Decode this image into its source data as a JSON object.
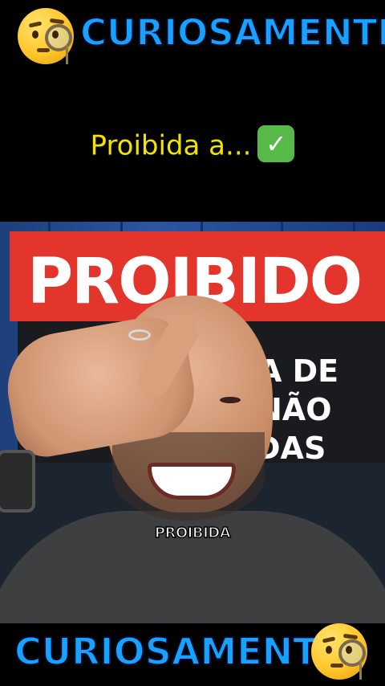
{
  "brand": {
    "top_title": "CURIOSAMENTE",
    "bottom_title": "CURIOSAMENTE",
    "emoji_icon": "face-with-monocle-icon"
  },
  "headline": {
    "text": "Proibida a...",
    "check_icon": "check-mark-button-icon"
  },
  "video": {
    "sign": {
      "main_word": "PROIBIDO",
      "line_1": "A DE",
      "line_2": "NÃO",
      "line_3": "DAS"
    },
    "caption": "PROIBIDA"
  },
  "colors": {
    "brand_blue": "#17a2ff",
    "headline_yellow": "#f3e400",
    "sign_red": "#e3352b",
    "check_green": "#57b947"
  }
}
